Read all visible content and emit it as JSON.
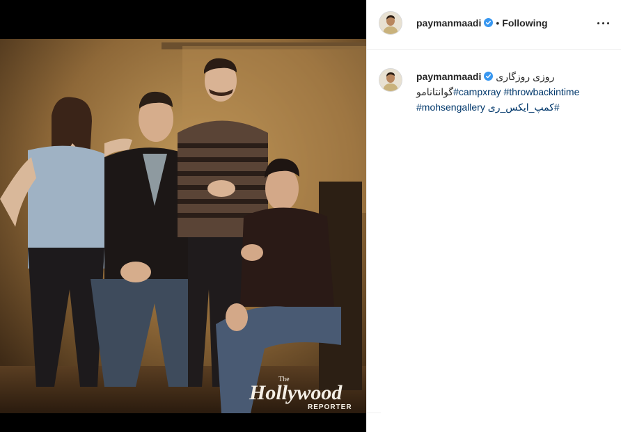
{
  "post": {
    "author": {
      "username": "paymanmaadi",
      "verified": true
    },
    "follow_status": "Following",
    "separator": "•",
    "more_icon": "more-horizontal-icon",
    "image": {
      "watermark_line1": "The",
      "watermark_line2": "Hollywood",
      "watermark_line3": "REPORTER"
    },
    "caption": {
      "username": "paymanmaadi",
      "text_persian_1": "روزی روزگاری",
      "hashtag_1": "#campxray",
      "hashtag_2": "#throwbackintime",
      "text_persian_2": "گوانتانامو",
      "hashtag_3": "#mohsengallery",
      "hashtag_4": "#کمپ_ایکس_ری"
    }
  },
  "colors": {
    "verified_badge": "#3897f0",
    "hashtag": "#00376b",
    "text": "#262626",
    "divider": "#efefef"
  }
}
